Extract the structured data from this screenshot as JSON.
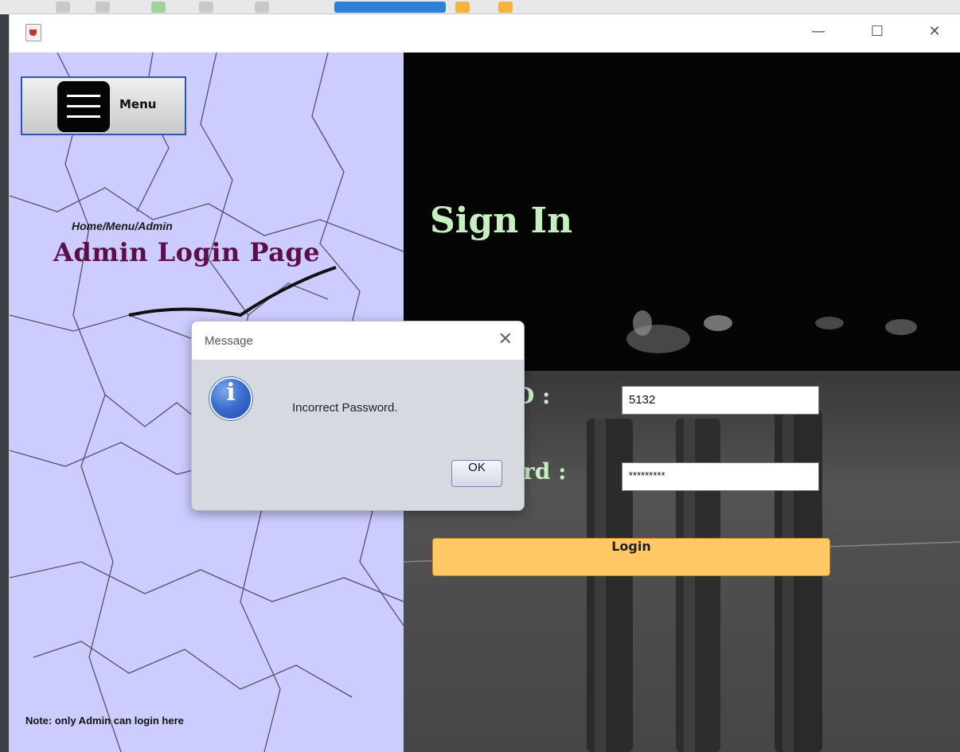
{
  "window": {
    "app_icon": "java-app-icon",
    "controls": {
      "minimize": "—",
      "maximize": "☐",
      "close": "✕"
    }
  },
  "left_panel": {
    "menu_label": "Menu",
    "breadcrumb": "Home/Menu/Admin",
    "title": "Admin Login Page",
    "note": "Note: only Admin can login here"
  },
  "right_panel": {
    "title": "Sign In",
    "id_label_visible": "D :",
    "id_value": "5132",
    "password_label_visible": "rd :",
    "password_value": "*********",
    "login_label": "Login"
  },
  "dialog": {
    "title": "Message",
    "close": "✕",
    "message": "Incorrect Password.",
    "icon": "info-icon",
    "icon_glyph": "i",
    "ok_label": "OK"
  },
  "colors": {
    "left_panel_bg": "#ccccff",
    "title_text": "#5a0f4a",
    "sign_in_text": "#c7f0c1",
    "login_button": "#ffc865"
  }
}
